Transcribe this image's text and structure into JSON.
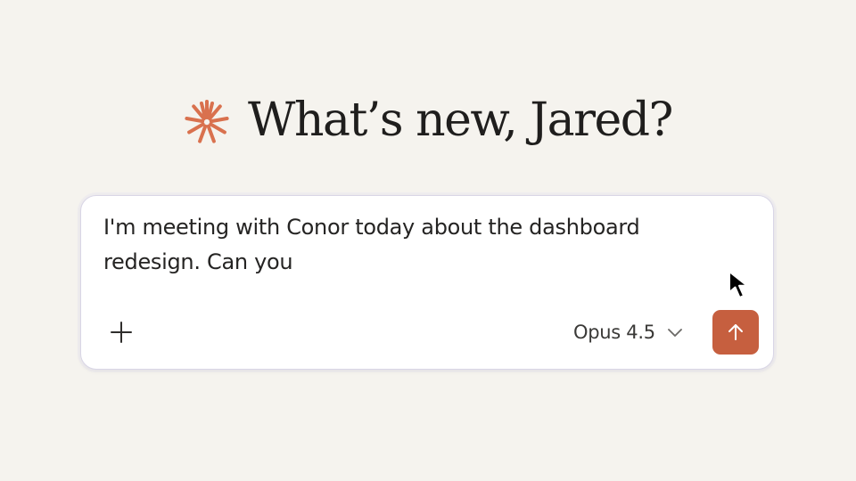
{
  "greeting": {
    "text": "What’s new, Jared?",
    "icon": "spark-logo-icon"
  },
  "composer": {
    "input_value": "I'm meeting with Conor today about the dashboard redesign. Can you",
    "add_icon": "plus-icon",
    "model_label": "Opus 4.5",
    "model_icon": "chevron-down-icon",
    "send_icon": "arrow-up-icon"
  },
  "colors": {
    "background": "#f5f3ee",
    "accent": "#c65f3f",
    "text": "#1f1e1d"
  }
}
